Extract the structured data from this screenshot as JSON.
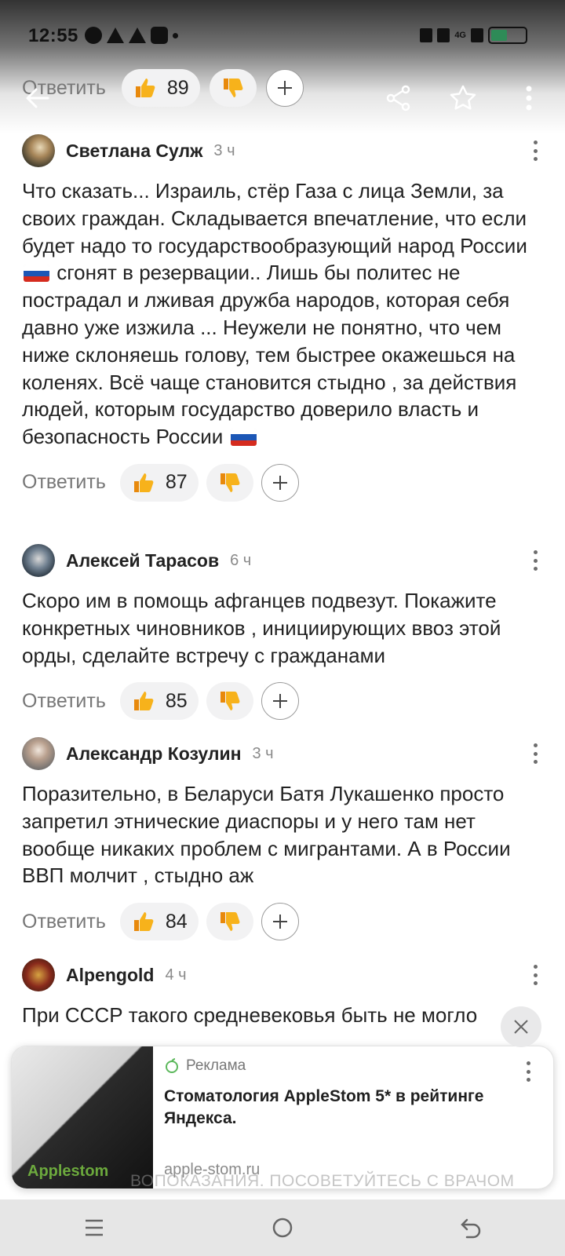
{
  "status_bar": {
    "time": "12:55",
    "network_label": "4G",
    "battery_label": "24"
  },
  "toolbar": {
    "icons": [
      "arrow-back-icon",
      "share-icon",
      "star-icon",
      "more-vertical-icon"
    ]
  },
  "prev_comment_actions": {
    "reply_label": "Ответить",
    "likes": "89"
  },
  "comments": [
    {
      "author": "Светлана Сулж",
      "time": "3 ч",
      "text_parts": [
        "Что сказать... Израиль, стёр Газа с лица Земли, за своих граждан. Складывается впечатление, что если будет надо то государствообразующий народ России ",
        " сгонят в резервации.. Лишь бы политес не пострадал и лживая дружба народов, которая себя давно уже изжила ... Неужели не понятно, что чем ниже склоняешь голову, тем быстрее окажешься на коленях. Всё чаще становится стыдно , за действия людей, которым государство доверило власть и безопасность России "
      ],
      "reply_label": "Ответить",
      "likes": "87"
    },
    {
      "author": "Алексей Тарасов",
      "time": "6 ч",
      "text": "Скоро им в помощь афганцев подвезут. Покажите конкретных чиновников , инициирующих ввоз этой орды, сделайте встречу с гражданами",
      "reply_label": "Ответить",
      "likes": "85"
    },
    {
      "author": "Александр Козулин",
      "time": "3 ч",
      "text": "Поразительно, в Беларуси Батя Лукашенко просто запретил этнические диаспоры и у него там нет вообще никаких проблем с мигрантами. А в России ВВП молчит , стыдно аж",
      "reply_label": "Ответить",
      "likes": "84"
    },
    {
      "author": "Alpengold",
      "time": "4 ч",
      "text": "При СССР такого средневековья быть не могло"
    }
  ],
  "ad": {
    "label": "Реклама",
    "title": "Стоматология AppleStom 5* в рейтинге Яндекса.",
    "domain": "apple-stom.ru",
    "image_logo_text": "Applestom",
    "warning": "ВОПОКАЗАНИЯ. ПОСОВЕТУЙТЕСЬ С ВРАЧОМ"
  },
  "colors": {
    "accent_like": "#f7a21b",
    "pill_bg": "#f2f2f3",
    "muted_text": "#777777"
  }
}
